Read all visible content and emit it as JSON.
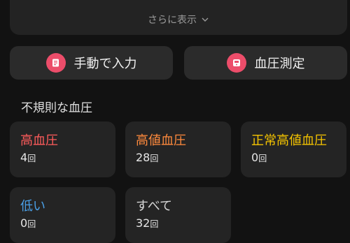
{
  "show_more": {
    "label": "さらに表示"
  },
  "actions": {
    "manual_label": "手動で入力",
    "measure_label": "血圧測定"
  },
  "section": {
    "title": "不規則な血圧"
  },
  "count_unit": "回",
  "categories": [
    {
      "label": "高血圧",
      "count": "4",
      "color": "#ff5b5b"
    },
    {
      "label": "高値血圧",
      "count": "28",
      "color": "#ff8a3d"
    },
    {
      "label": "正常高値血圧",
      "count": "0",
      "color": "#f5c400"
    },
    {
      "label": "低い",
      "count": "0",
      "color": "#4a9fe6"
    },
    {
      "label": "すべて",
      "count": "32",
      "color": "#d6d6d6"
    }
  ],
  "colors": {
    "background": "#121212",
    "card": "#242424",
    "accent_pink": "#ec4d6a"
  },
  "icons": {
    "chevron": "chevron-down-icon",
    "manual": "manual-entry-icon",
    "measure": "bp-monitor-icon"
  }
}
